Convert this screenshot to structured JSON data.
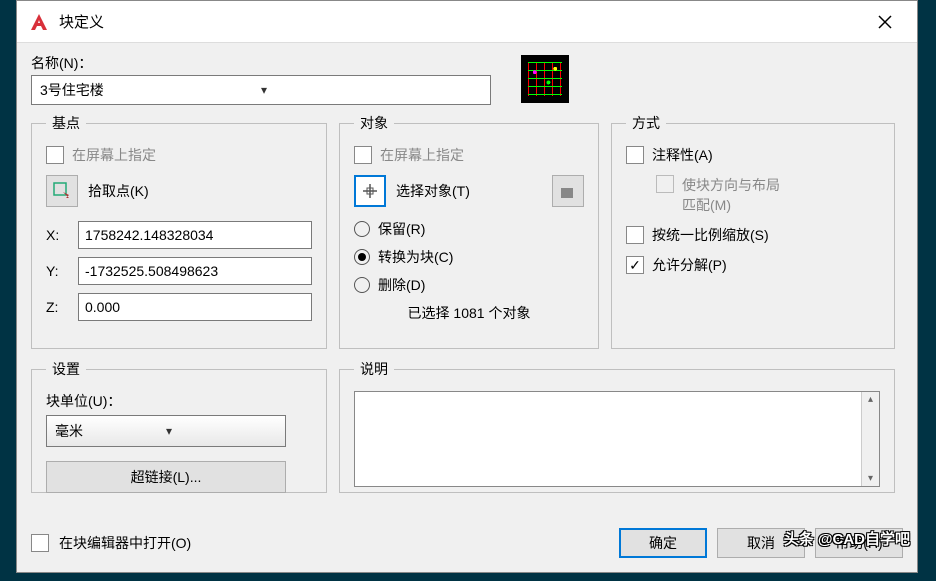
{
  "titlebar": {
    "title": "块定义"
  },
  "name": {
    "label": "名称(N)：",
    "value": "3号住宅楼"
  },
  "base_point": {
    "legend": "基点",
    "specify_on_screen": "在屏幕上指定",
    "pick_point": "拾取点(K)",
    "x_label": "X:",
    "x": "1758242.148328034",
    "y_label": "Y:",
    "y": "-1732525.508498623",
    "z_label": "Z:",
    "z": "0.000"
  },
  "objects": {
    "legend": "对象",
    "specify_on_screen": "在屏幕上指定",
    "select_objects": "选择对象(T)",
    "retain": "保留(R)",
    "convert": "转换为块(C)",
    "delete": "删除(D)",
    "selected_count": "已选择 1081 个对象"
  },
  "behavior": {
    "legend": "方式",
    "annotative": "注释性(A)",
    "match_orientation_l1": "使块方向与布局",
    "match_orientation_l2": "匹配(M)",
    "scale_uniformly": "按统一比例缩放(S)",
    "allow_exploding": "允许分解(P)"
  },
  "settings": {
    "legend": "设置",
    "unit_label": "块单位(U)：",
    "unit_value": "毫米",
    "hyperlink": "超链接(L)..."
  },
  "description": {
    "legend": "说明"
  },
  "open_in_editor": "在块编辑器中打开(O)",
  "buttons": {
    "ok": "确定",
    "cancel": "取消",
    "help": "帮助(H)"
  },
  "watermark": "头条 @CAD自学吧"
}
